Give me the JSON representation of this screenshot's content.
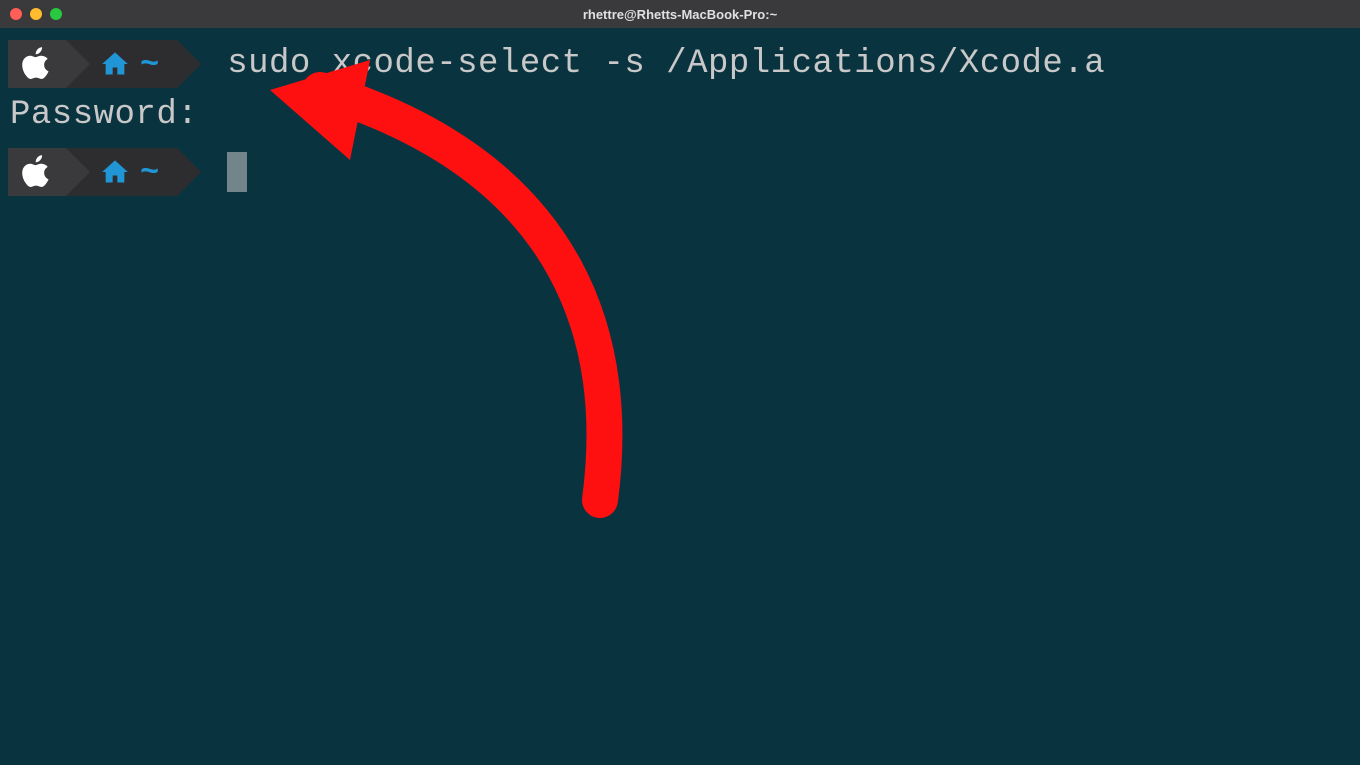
{
  "titlebar": {
    "title": "rhettre@Rhetts-MacBook-Pro:~"
  },
  "terminal": {
    "command": "sudo xcode-select -s /Applications/Xcode.a",
    "password_prompt": "Password:",
    "prompt_tilde": "~"
  },
  "colors": {
    "bg": "#0a3340",
    "segment_dark": "#3a3a3c",
    "segment_darker": "#2d2d2f",
    "accent_blue": "#2196d6",
    "text": "#c8c8c8",
    "arrow": "#ff1010"
  }
}
